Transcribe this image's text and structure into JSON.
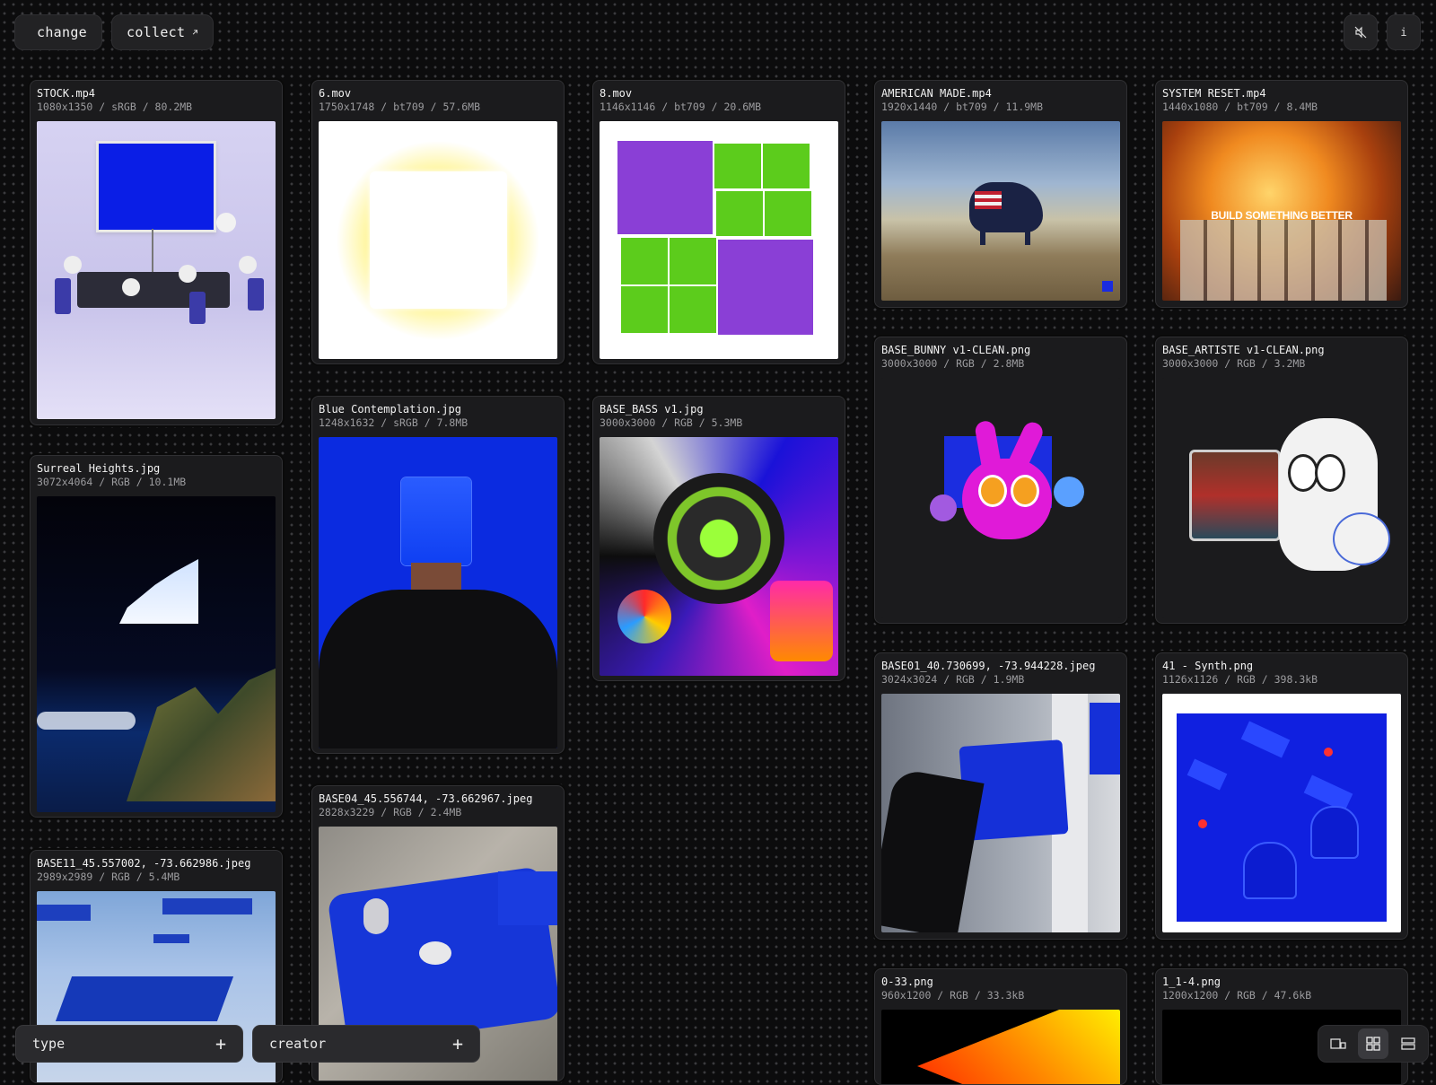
{
  "toolbar": {
    "change_label": "change",
    "collect_label": "collect"
  },
  "filters": {
    "type_label": "type",
    "creator_label": "creator"
  },
  "cards": [
    {
      "name": "STOCK.mp4",
      "meta": "1080x1350 / sRGB / 80.2MB"
    },
    {
      "name": "Surreal Heights.jpg",
      "meta": "3072x4064 / RGB / 10.1MB"
    },
    {
      "name": "BASE11_45.557002, -73.662986.jpeg",
      "meta": "2989x2989 / RGB / 5.4MB"
    },
    {
      "name": "6.mov",
      "meta": "1750x1748 / bt709 / 57.6MB"
    },
    {
      "name": "Blue Contemplation.jpg",
      "meta": "1248x1632 / sRGB / 7.8MB"
    },
    {
      "name": "BASE04_45.556744, -73.662967.jpeg",
      "meta": "2828x3229 / RGB / 2.4MB"
    },
    {
      "name": "8.mov",
      "meta": "1146x1146 / bt709 / 20.6MB"
    },
    {
      "name": "BASE_BASS v1.jpg",
      "meta": "3000x3000 / RGB / 5.3MB"
    },
    {
      "name": "AMERICAN MADE.mp4",
      "meta": "1920x1440 / bt709 / 11.9MB"
    },
    {
      "name": "BASE_BUNNY v1-CLEAN.png",
      "meta": "3000x3000 / RGB / 2.8MB"
    },
    {
      "name": "BASE01_40.730699, -73.944228.jpeg",
      "meta": "3024x3024 / RGB / 1.9MB"
    },
    {
      "name": "0-33.png",
      "meta": "960x1200 / RGB / 33.3kB"
    },
    {
      "name": "SYSTEM RESET.mp4",
      "meta": "1440x1080 / bt709 / 8.4MB"
    },
    {
      "name": "BASE_ARTISTE v1-CLEAN.png",
      "meta": "3000x3000 / RGB / 3.2MB"
    },
    {
      "name": "41 - Synth.png",
      "meta": "1126x1126 / RGB / 398.3kB"
    },
    {
      "name": "1_1-4.png",
      "meta": "1200x1200 / RGB / 47.6kB"
    }
  ],
  "image_text": {
    "system_reset_overlay": "BUILD SOMETHING BETTER"
  },
  "view_modes": [
    "single-view",
    "grid-view",
    "list-view"
  ],
  "icons": [
    "chevron-left-icon",
    "arrow-up-right-icon",
    "mute-icon",
    "info-icon",
    "plus-icon"
  ]
}
